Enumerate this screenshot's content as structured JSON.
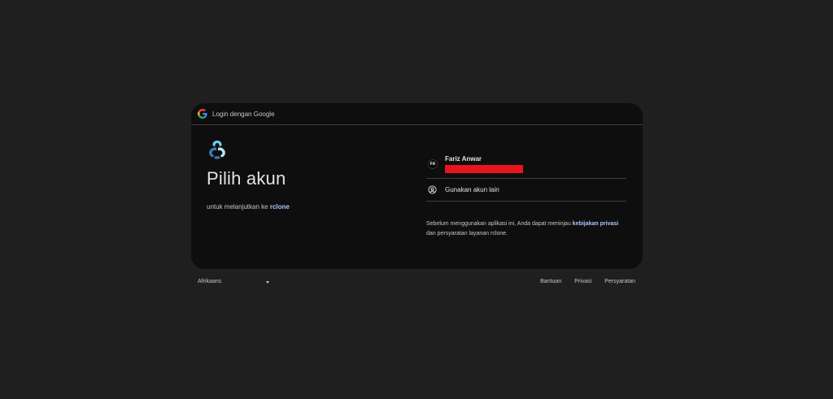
{
  "header": {
    "text": "Login dengan Google",
    "icon": "google-icon"
  },
  "left": {
    "app_icon": "rclone-logo-icon",
    "title": "Pilih akun",
    "subtitle_prefix": "untuk melanjutkan ke ",
    "app_name": "rclone"
  },
  "accounts": [
    {
      "initials": "FA",
      "name": "Fariz Anwar",
      "email_redacted": true
    }
  ],
  "other_account": {
    "label": "Gunakan akun lain",
    "icon": "person-circle-icon"
  },
  "privacy": {
    "text_before": "Sebelum menggunakan aplikasi ini, Anda dapat meninjau ",
    "link_text": "kebijakan privasi",
    "text_after": " dan persyaratan layanan rclone."
  },
  "footer": {
    "language": "Afrikaans",
    "links": [
      "Bantuan",
      "Privasi",
      "Persyaratan"
    ]
  },
  "colors": {
    "background": "#1f1f20",
    "card": "#0e0e0e",
    "link": "#a8c7fa",
    "redaction": "#e8141b"
  }
}
